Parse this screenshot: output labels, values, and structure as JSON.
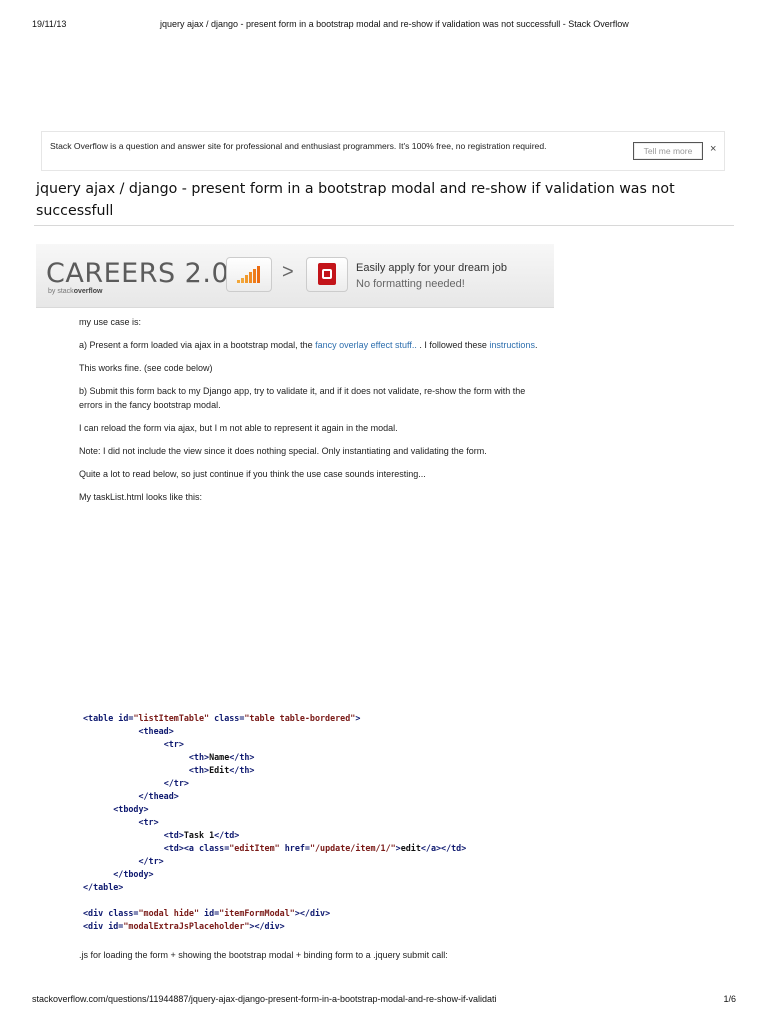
{
  "print_header": {
    "date": "19/11/13",
    "title": "jquery ajax / django - present form in a bootstrap modal and re-show if validation was not successfull - Stack Overflow"
  },
  "notice": {
    "text": "Stack Overflow is a question and answer site for professional and enthusiast programmers. It's 100% free, no registration required.",
    "button_label": "Tell me more",
    "close_glyph": "×"
  },
  "question": {
    "title": "jquery ajax / django - present form in a bootstrap modal and re-show if validation was not successfull"
  },
  "careers_banner": {
    "logo_text": "CAREERS 2.0",
    "byline_prefix": "by stack",
    "byline_brand": "overflow",
    "chart_icon": "signal-bars-icon",
    "arrow_glyph": ">",
    "pdf_icon": "pdf-document-icon",
    "promo_line1": "Easily apply for your dream job",
    "promo_line2": "No formatting needed!"
  },
  "post": {
    "p1": "my use case is:",
    "p2_before": "a) Present a form loaded via ajax in a bootstrap modal, the ",
    "p2_link1": "fancy overlay effect stuff..",
    "p2_middle": " . I followed these ",
    "p2_link2": "instructions",
    "p2_after": ".",
    "p3": "This works fine. (see code below)",
    "p4": "b) Submit this form back to my Django app, try to validate it, and if it does not validate, re-show the form with the errors in the fancy bootstrap modal.",
    "p5": "I can reload the form via ajax, but I m not able to represent it again in the modal.",
    "p6": "Note: I did not include the view since it does nothing special. Only instantiating and validating the form.",
    "p7": "Quite a lot to read below, so just continue if you think the use case sounds interesting...",
    "p8": "My taskList.html looks like this:"
  },
  "code": {
    "l01_open": "<table ",
    "l01_attr1": "id=",
    "l01_val1": "\"listItemTable\"",
    "l01_attr2": " class=",
    "l01_val2": "\"table table-bordered\"",
    "l01_close": ">",
    "l02": "<thead>",
    "l03": "<tr>",
    "l04_open": "<th>",
    "l04_text": "Name",
    "l04_close": "</th>",
    "l05_open": "<th>",
    "l05_text": "Edit",
    "l05_close": "</th>",
    "l06": "</tr>",
    "l07": "</thead>",
    "l08": "<tbody>",
    "l09": "<tr>",
    "l10_open": "<td>",
    "l10_text": "Task 1",
    "l10_close": "</td>",
    "l11_td": "<td>",
    "l11_a": "<a ",
    "l11_attr1": "class=",
    "l11_val1": "\"editItem\"",
    "l11_attr2": " href=",
    "l11_val2": "\"/update/item/1/\"",
    "l11_gt": ">",
    "l11_text": "edit",
    "l11_close": "</a></td>",
    "l12": "</tr>",
    "l13": "</tbody>",
    "l14": "</table>",
    "l16_open": "<div ",
    "l16_attr1": "class=",
    "l16_val1": "\"modal hide\"",
    "l16_attr2": " id=",
    "l16_val2": "\"itemFormModal\"",
    "l16_close": "></div>",
    "l17_open": "<div ",
    "l17_attr1": "id=",
    "l17_val1": "\"modalExtraJsPlaceholder\"",
    "l17_close": "></div>"
  },
  "after_code": ".js for loading the form + showing the bootstrap modal + binding form to a .jquery submit call:",
  "print_footer": {
    "url": "stackoverflow.com/questions/11944887/jquery-ajax-django-present-form-in-a-bootstrap-modal-and-re-show-if-validati",
    "page": "1/6"
  }
}
